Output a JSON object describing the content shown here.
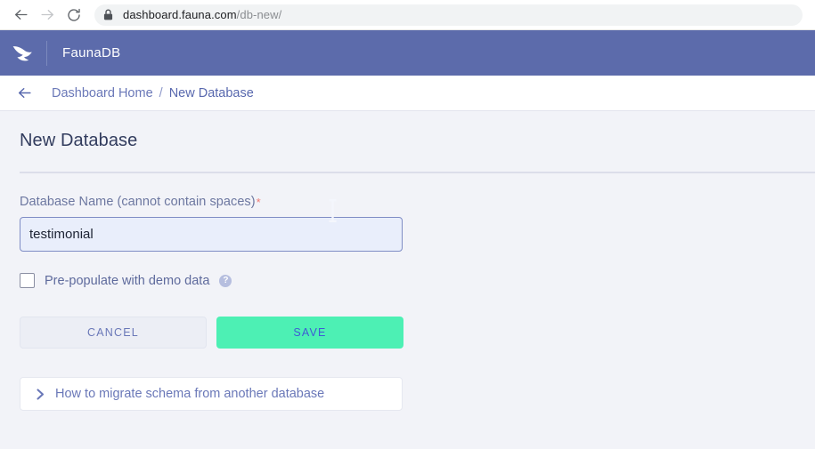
{
  "browser": {
    "back_icon": "arrow-left-icon",
    "forward_icon": "arrow-right-icon",
    "reload_icon": "reload-icon",
    "lock_icon": "lock-icon",
    "url_domain": "dashboard.fauna.com",
    "url_path": "/db-new/"
  },
  "app_header": {
    "logo_icon": "fauna-bird-logo",
    "brand": "FaunaDB",
    "background": "#5c6bab"
  },
  "breadcrumb": {
    "back_icon": "arrow-left-icon",
    "home": "Dashboard Home",
    "separator": "/",
    "current": "New Database"
  },
  "page": {
    "title": "New Database",
    "field": {
      "label": "Database Name (cannot contain spaces)",
      "required_marker": "*",
      "value": "testimonial",
      "placeholder": ""
    },
    "checkbox": {
      "label": "Pre-populate with demo data",
      "checked": false,
      "help_icon": "question-circle-icon",
      "help_glyph": "?"
    },
    "buttons": {
      "cancel": "CANCEL",
      "save": "SAVE"
    },
    "accordion": {
      "chevron_icon": "chevron-right-icon",
      "label": "How to migrate schema from another database"
    }
  },
  "colors": {
    "header_purple": "#5c6bab",
    "accent_link": "#6a78b8",
    "save_green": "#4df0b4",
    "save_text": "#3f5bd4",
    "required_red": "#ef7b74",
    "page_bg": "#f2f3f8",
    "input_bg": "#e9eefb",
    "input_border": "#7f8dc5"
  },
  "cursor": {
    "type": "text-ibeam-cursor"
  }
}
